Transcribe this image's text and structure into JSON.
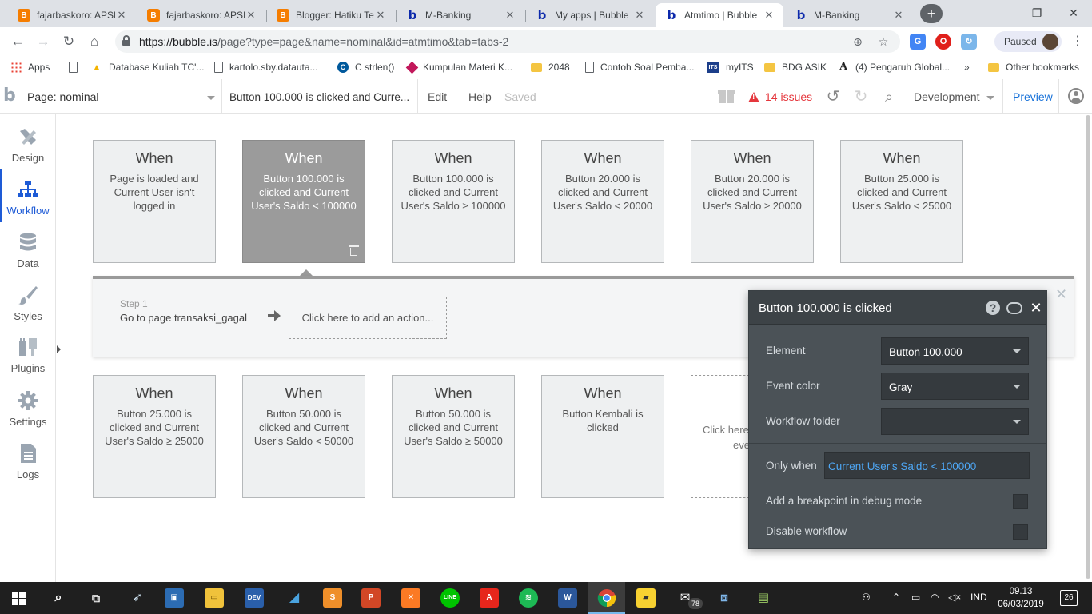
{
  "browser": {
    "tabs": [
      {
        "label": "fajarbaskoro: APSI",
        "favicon": "blogger-icon"
      },
      {
        "label": "fajarbaskoro: APSI",
        "favicon": "blogger-icon"
      },
      {
        "label": "Blogger: Hatiku Te",
        "favicon": "blogger-icon"
      },
      {
        "label": "M-Banking",
        "favicon": "bubble-icon"
      },
      {
        "label": "My apps | Bubble",
        "favicon": "bubble-icon"
      },
      {
        "label": "Atmtimo | Bubble",
        "favicon": "bubble-icon",
        "active": true
      },
      {
        "label": "M-Banking",
        "favicon": "bubble-icon"
      }
    ],
    "url_host": "https://bubble.is",
    "url_path": "/page?type=page&name=nominal&id=atmtimo&tab=tabs-2",
    "profile_status": "Paused",
    "bookmarks": [
      {
        "label": "Apps",
        "icon": "apps-grid-icon"
      },
      {
        "label": "",
        "icon": "page-icon"
      },
      {
        "label": "Database Kuliah TC'...",
        "icon": "drive-icon"
      },
      {
        "label": "kartolo.sby.datauta...",
        "icon": "page-icon"
      },
      {
        "label": "C strlen()",
        "icon": "cplusplus-icon"
      },
      {
        "label": "Kumpulan Materi K...",
        "icon": "site-icon"
      },
      {
        "label": "2048",
        "icon": "folder-icon"
      },
      {
        "label": "Contoh Soal Pemba...",
        "icon": "page-icon"
      },
      {
        "label": "myITS",
        "icon": "its-icon"
      },
      {
        "label": "BDG ASIK",
        "icon": "folder-icon"
      },
      {
        "label": "(4) Pengaruh Global...",
        "icon": "academia-icon"
      },
      {
        "label": "»",
        "icon": ""
      },
      {
        "label": "Other bookmarks",
        "icon": "folder-icon"
      }
    ]
  },
  "editor": {
    "page_select": "Page: nominal",
    "workflow_select": "Button 100.000 is clicked and Curre...",
    "menu": {
      "edit": "Edit",
      "help": "Help",
      "saved": "Saved"
    },
    "issues": "14 issues",
    "environment": "Development",
    "preview": "Preview"
  },
  "sidebar": {
    "items": [
      {
        "label": "Design",
        "icon": "design-icon"
      },
      {
        "label": "Workflow",
        "icon": "workflow-icon",
        "active": true
      },
      {
        "label": "Data",
        "icon": "database-icon"
      },
      {
        "label": "Styles",
        "icon": "brush-icon"
      },
      {
        "label": "Plugins",
        "icon": "plugin-icon"
      },
      {
        "label": "Settings",
        "icon": "gear-icon"
      },
      {
        "label": "Logs",
        "icon": "logs-icon"
      }
    ]
  },
  "events": {
    "when_label": "When",
    "row1": [
      "Page is loaded and Current User isn't logged in",
      "Button 100.000 is clicked and Current User's Saldo < 100000",
      "Button 100.000 is clicked and Current User's Saldo ≥ 100000",
      "Button 20.000 is clicked and Current User's Saldo < 20000",
      "Button 20.000 is clicked and Current User's Saldo ≥ 20000",
      "Button 25.000 is clicked and Current User's Saldo < 25000"
    ],
    "row2": [
      "Button 25.000 is clicked and Current User's Saldo ≥ 25000",
      "Button 50.000 is clicked and Current User's Saldo < 50000",
      "Button 50.000 is clicked and Current User's Saldo ≥ 50000",
      "Button Kembali is clicked"
    ],
    "add_event_line1": "Click here",
    "add_event_line2": "eve"
  },
  "steps": {
    "step_number": "Step 1",
    "step_name": "Go to page transaksi_gagal",
    "add_action": "Click here to add an action..."
  },
  "property_editor": {
    "title": "Button 100.000 is clicked",
    "element_label": "Element",
    "element_value": "Button 100.000",
    "event_color_label": "Event color",
    "event_color_value": "Gray",
    "folder_label": "Workflow folder",
    "folder_value": "",
    "only_when_label": "Only when",
    "only_when_value": "Current User's Saldo < 100000",
    "breakpoint_label": "Add a breakpoint in debug mode",
    "disable_label": "Disable workflow"
  },
  "taskbar": {
    "apps": [
      "windows-start-icon",
      "search-icon",
      "task-view-icon",
      "wing-icon",
      "virtualbox-icon",
      "file-explorer-icon",
      "devcpp-icon",
      "shark-icon",
      "sublime-icon",
      "powerpoint-icon",
      "xampp-icon",
      "line-icon",
      "acrobat-icon",
      "spotify-icon",
      "word-icon",
      "chrome-icon",
      "sticky-notes-icon",
      "mail-icon",
      "network-icon",
      "installer-icon"
    ],
    "mail_badge": "78",
    "language": "IND",
    "time": "09.13",
    "date": "06/03/2019",
    "notification_count": "26"
  },
  "colors": {
    "selected_event": "#9b9b9b",
    "event_card": "#eef0f1",
    "accent_blue": "#1e5bd6",
    "issues_red": "#e5373d",
    "condition_blue": "#4ea7f5",
    "property_panel": "#4b5257"
  }
}
